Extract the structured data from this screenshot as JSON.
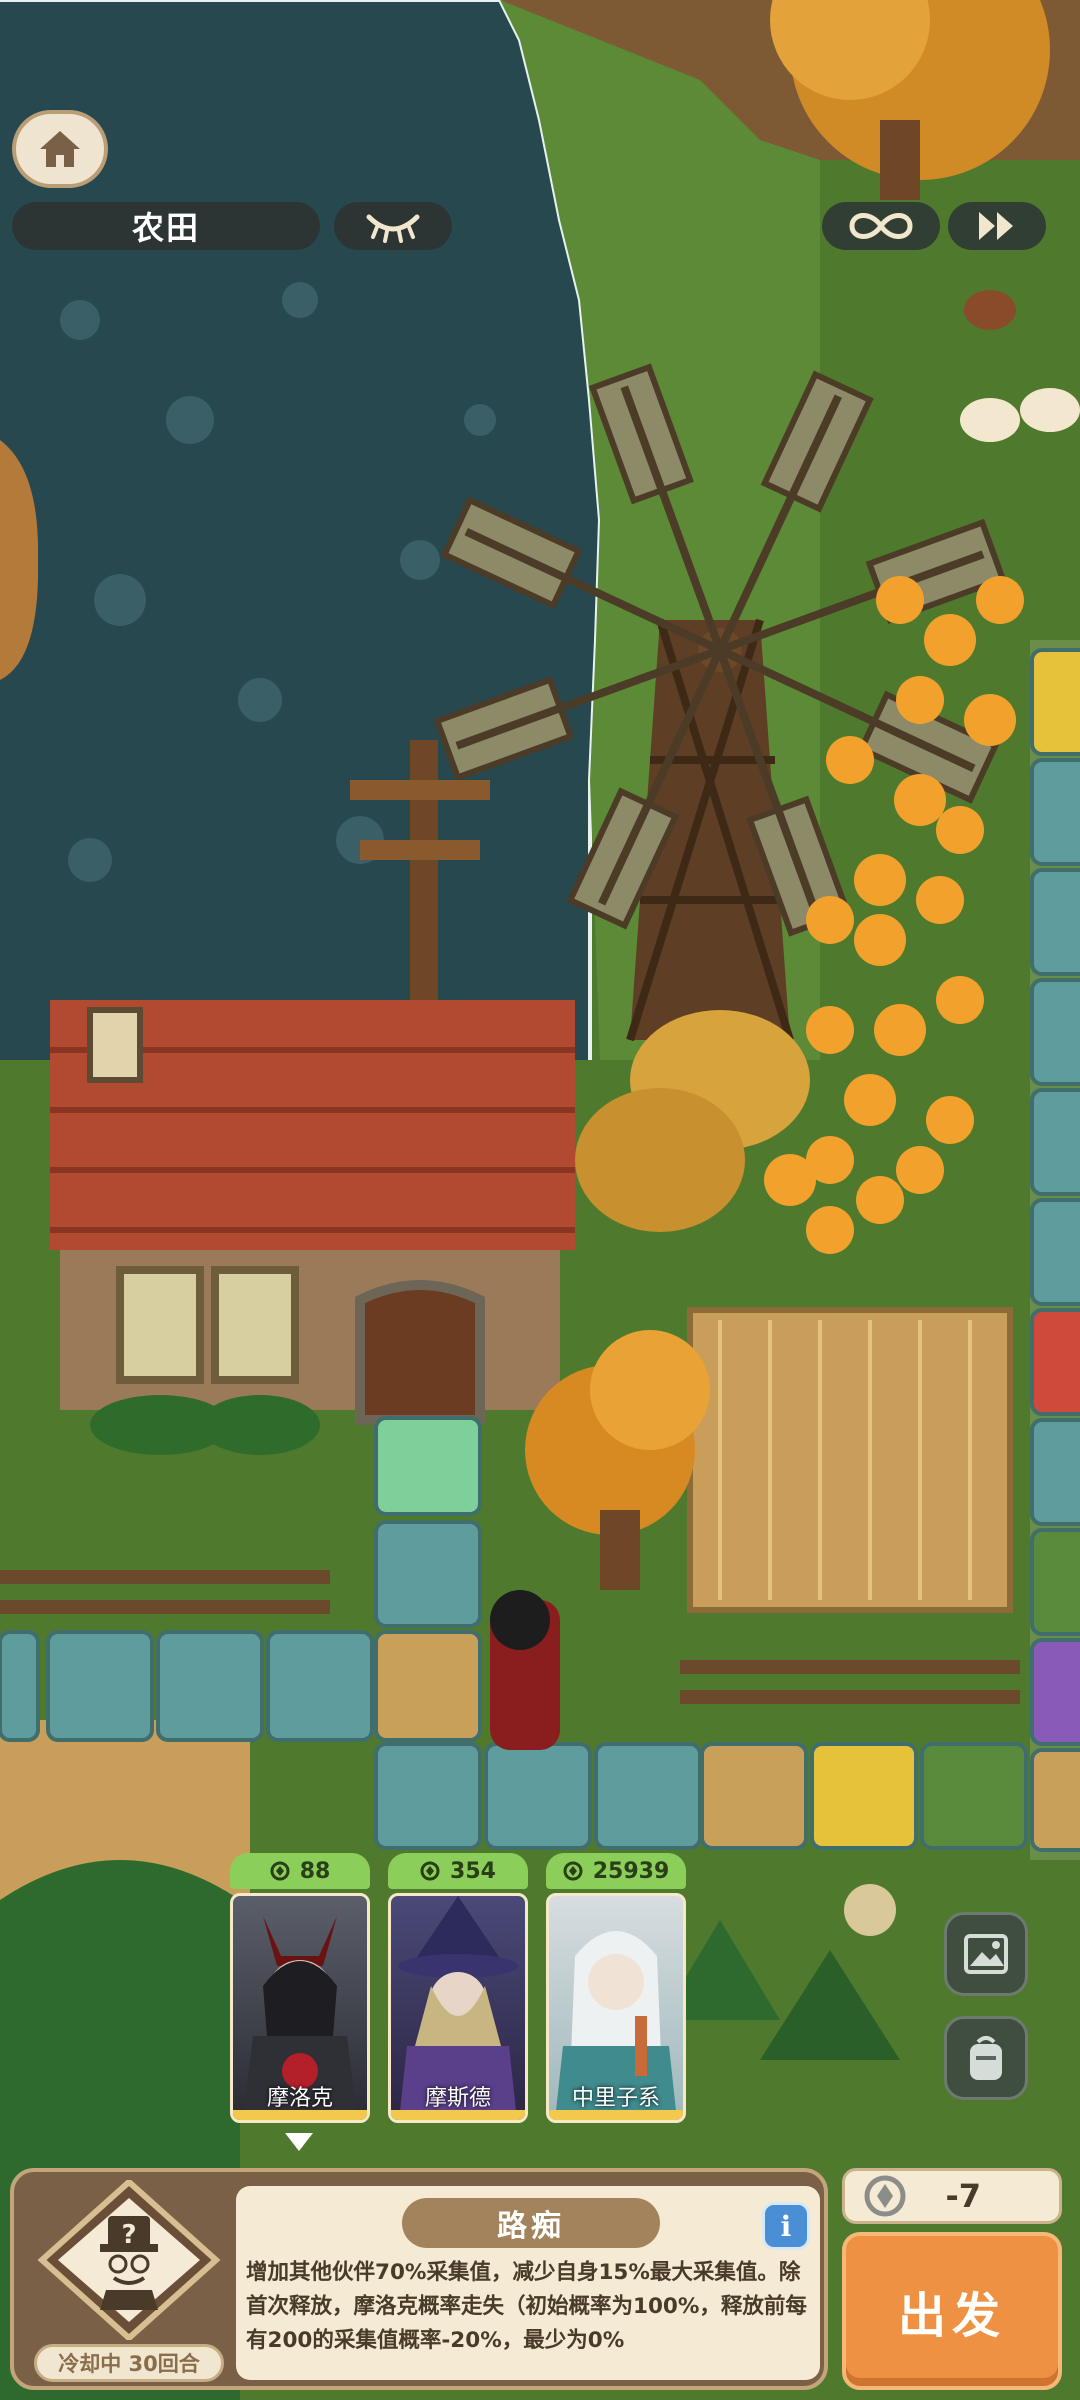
{
  "hud": {
    "map_name": "农田",
    "home_icon": "home-icon",
    "eye_icon": "eye-closed-icon",
    "loop_icon": "infinity-icon",
    "ff_icon": "fast-forward-icon"
  },
  "party": [
    {
      "score": "88",
      "name": "摩洛克",
      "selected": true
    },
    {
      "score": "354",
      "name": "摩斯德",
      "selected": false
    },
    {
      "score": "25939",
      "name": "中里子系",
      "selected": false
    }
  ],
  "side_buttons": [
    "gallery-icon",
    "backpack-icon"
  ],
  "skill": {
    "title": "路痴",
    "description": "增加其他伙伴70%采集值，减少自身15%最大采集值。除首次释放，摩洛克概率走失（初始概率为100%，释放前每有200的采集值概率-20%，最少为0%",
    "cooldown": "冷却中 30回合",
    "icon": "mystery-gentleman-icon"
  },
  "cost": {
    "value": "-7",
    "icon": "energy-icon"
  },
  "go_button": "出发",
  "colors": {
    "water": "#27484f",
    "grass": "#4f7a2e",
    "roof": "#b24a32",
    "tile_teal": "#5f9c9d",
    "tile_gold": "#e5c23a",
    "accent_orange": "#ee9142"
  }
}
